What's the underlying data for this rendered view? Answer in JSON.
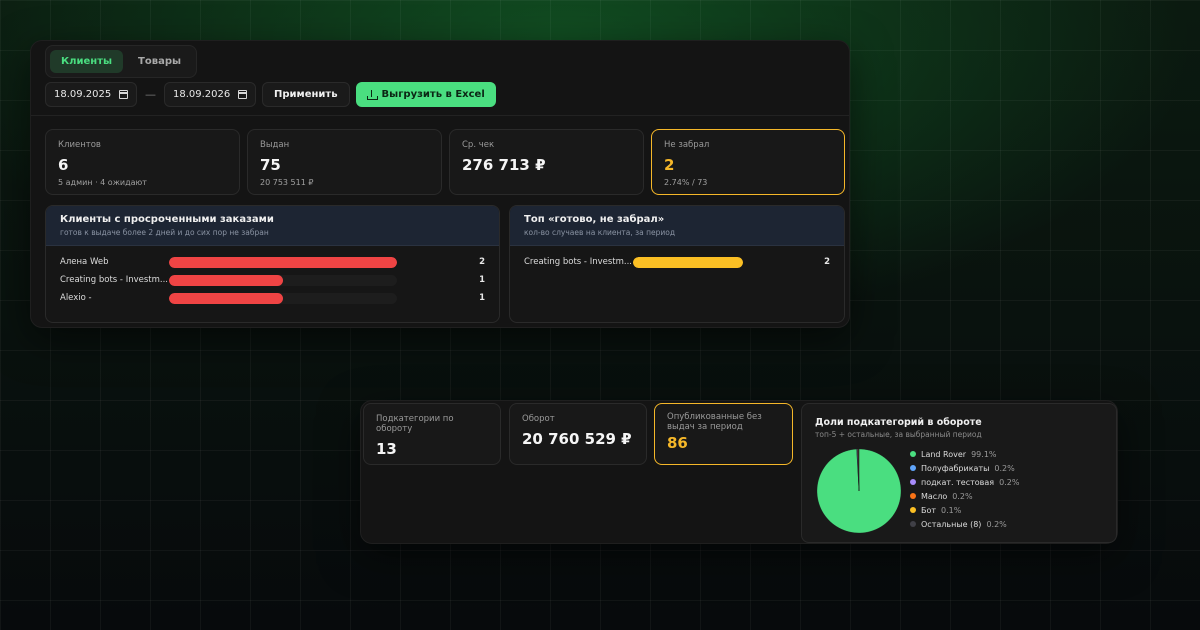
{
  "tabs": [
    {
      "label": "Клиенты",
      "active": true
    },
    {
      "label": "Товары",
      "active": false
    }
  ],
  "filters": {
    "date_from": "18.09.2025",
    "separator": "—",
    "date_to": "18.09.2026",
    "apply_label": "Применить",
    "export_label": "Выгрузить в Excel"
  },
  "stats": [
    {
      "label": "Клиентов",
      "value": "6",
      "sub": "5 админ · 4 ожидают",
      "highlight": false
    },
    {
      "label": "Выдан",
      "value": "75",
      "sub": "20 753 511 ₽",
      "highlight": false
    },
    {
      "label": "Ср. чек",
      "value": "276 713 ₽",
      "sub": "",
      "highlight": false
    },
    {
      "label": "Не забрал",
      "value": "2",
      "sub": "2.74% / 73",
      "highlight": true
    }
  ],
  "overdue": {
    "title": "Клиенты с просроченными заказами",
    "subtitle": "готов к выдаче более 2 дней и до сих пор не забран",
    "color": "#ef4444",
    "max": 2,
    "rows": [
      {
        "label": "Алена Web",
        "value": 2
      },
      {
        "label": "Creating bots - Investm...",
        "value": 1
      },
      {
        "label": "Alexio -",
        "value": 1
      }
    ]
  },
  "not_picked": {
    "title": "Топ «готово, не забрал»",
    "subtitle": "кол-во случаев на клиента, за период",
    "color": "#fbbf24",
    "max": 2,
    "rows": [
      {
        "label": "Creating bots - Investm...",
        "value": 2
      }
    ]
  },
  "bottom_stats": [
    {
      "label": "Подкатегории по обороту",
      "value": "13",
      "highlight": false
    },
    {
      "label": "Оборот",
      "value": "20 760 529 ₽",
      "highlight": false
    },
    {
      "label": "Опубликованные без выдач за период",
      "value": "86",
      "highlight": true
    }
  ],
  "chart_data": {
    "type": "pie",
    "title": "Доли подкатегорий в обороте",
    "subtitle": "топ-5 + остальные, за выбранный период",
    "slices": [
      {
        "name": "Land Rover",
        "value": 99.1,
        "label": "99.1%",
        "color": "#4ade80"
      },
      {
        "name": "Полуфабрикаты",
        "value": 0.2,
        "label": "0.2%",
        "color": "#60a5fa"
      },
      {
        "name": "подкат. тестовая",
        "value": 0.2,
        "label": "0.2%",
        "color": "#a78bfa"
      },
      {
        "name": "Масло",
        "value": 0.2,
        "label": "0.2%",
        "color": "#f97316"
      },
      {
        "name": "Бот",
        "value": 0.1,
        "label": "0.1%",
        "color": "#fbbf24"
      },
      {
        "name": "Остальные (8)",
        "value": 0.2,
        "label": "0.2%",
        "color": "#3f3f46"
      }
    ]
  }
}
